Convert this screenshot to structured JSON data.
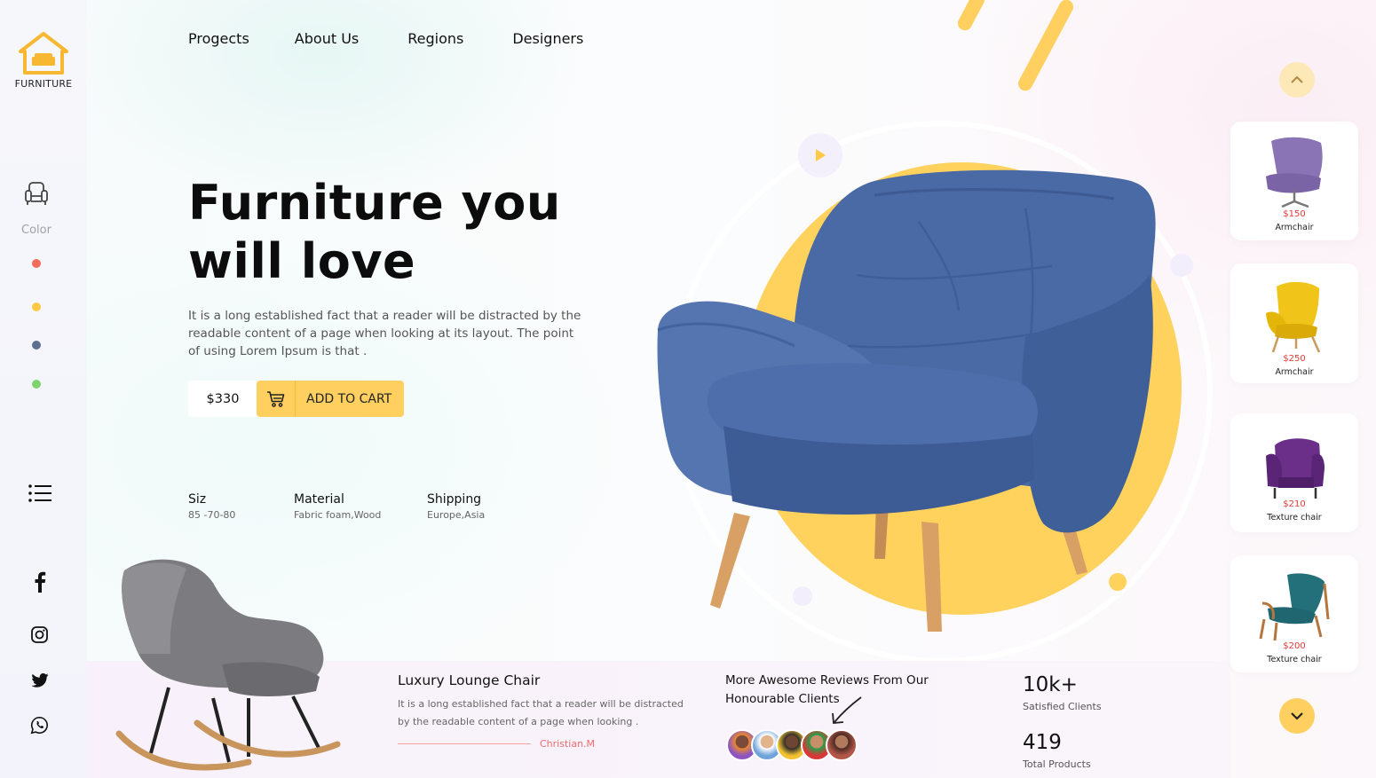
{
  "brand": {
    "name": "FURNITURE"
  },
  "nav": {
    "items": [
      "Progects",
      "About Us",
      "Regions",
      "Designers"
    ]
  },
  "sidebar": {
    "color_label": "Color",
    "color_options": [
      "#f26b5b",
      "#ffc845",
      "#5c6f8e",
      "#7ed56f"
    ],
    "social": [
      "facebook-icon",
      "instagram-icon",
      "twitter-icon",
      "whatsapp-icon"
    ]
  },
  "hero": {
    "title": "Furniture you will love",
    "description": "It is a long established fact that a reader will be distracted by the readable content of a page when looking at its layout. The point of using Lorem Ipsum is that .",
    "price": "$330",
    "cta": "ADD TO CART",
    "specs": [
      {
        "key": "Siz",
        "value": "85 -70-80"
      },
      {
        "key": "Material",
        "value": "Fabric foam,Wood"
      },
      {
        "key": "Shipping",
        "value": "Europe,Asia"
      }
    ]
  },
  "products": [
    {
      "price": "$150",
      "name": "Armchair",
      "color": "#8a74b5"
    },
    {
      "price": "$250",
      "name": "Armchair",
      "color": "#f0c419"
    },
    {
      "price": "$210",
      "name": "Texture chair",
      "color": "#6b2f8a"
    },
    {
      "price": "$200",
      "name": "Texture chair",
      "color": "#24707a"
    }
  ],
  "feature": {
    "title": "Luxury Lounge Chair",
    "description": "It is a long established fact that a reader will be distracted by the readable content of a page when looking .",
    "author": "Christian.M"
  },
  "reviews": {
    "text": "More Awesome Reviews From Our Honourable Clients"
  },
  "stats": [
    {
      "value": "10k+",
      "label": "Satisfied  Clients"
    },
    {
      "value": "419",
      "label": "Total Products"
    }
  ],
  "colors": {
    "accent": "#ffd060",
    "price_red": "#e53935",
    "chair_blue": "#4a6aa5"
  }
}
